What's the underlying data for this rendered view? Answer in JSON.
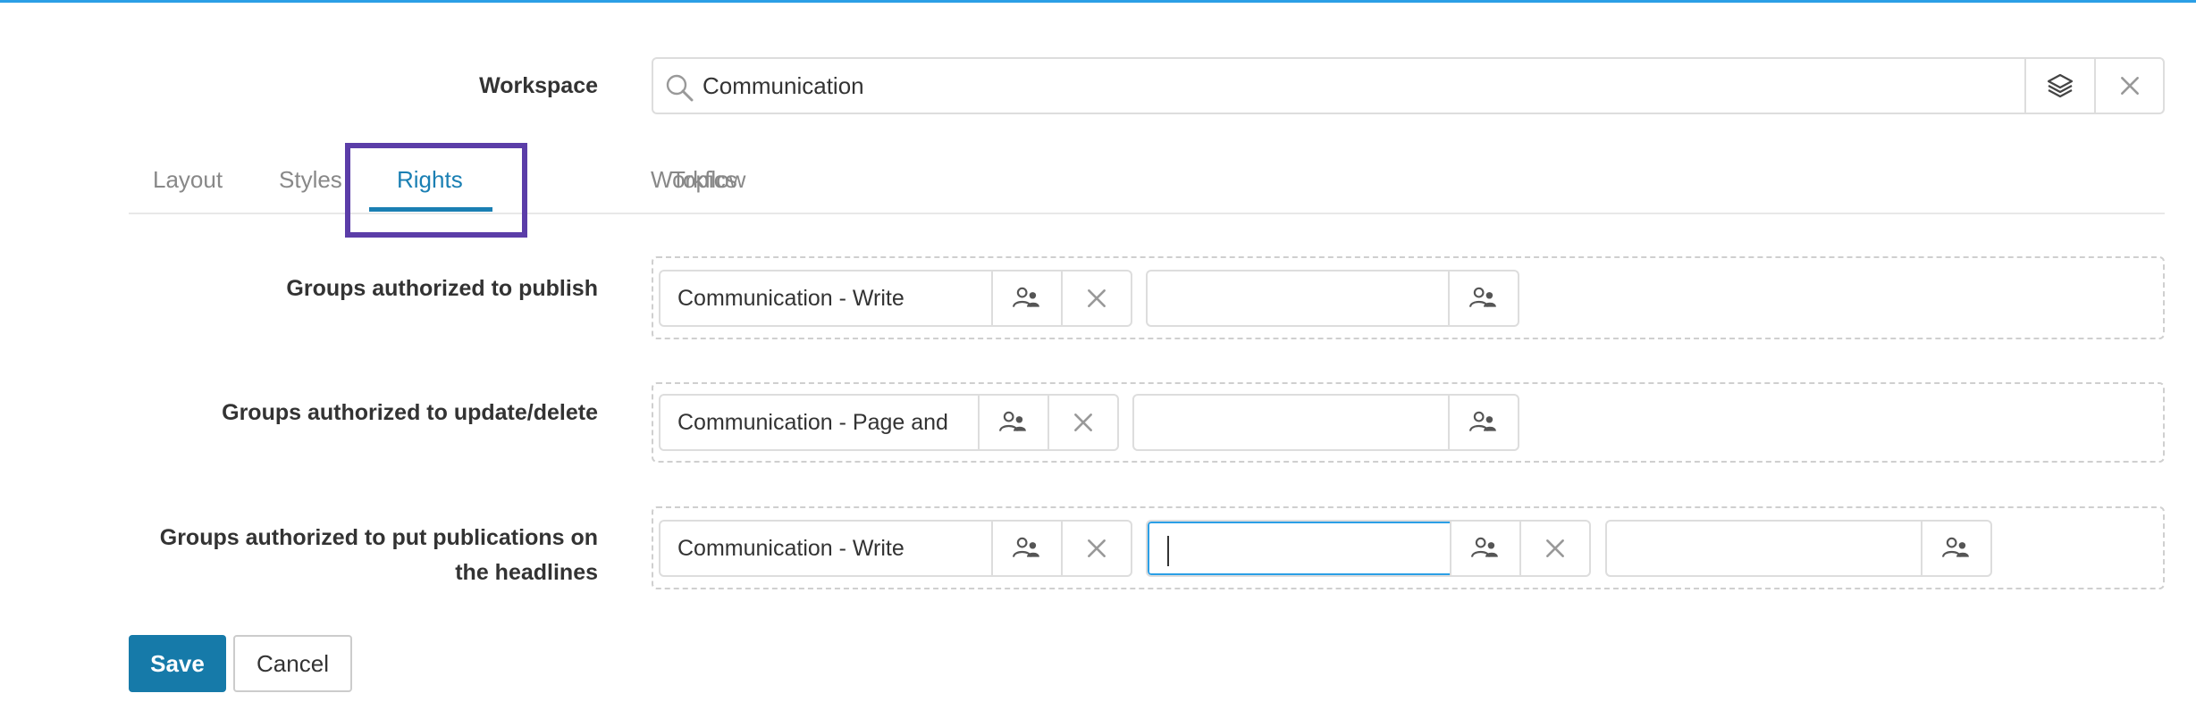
{
  "workspace": {
    "label": "Workspace",
    "value": "Communication",
    "icons": {
      "search": "search-icon",
      "layers": "layers-icon",
      "clear": "close-icon"
    }
  },
  "tabs": [
    {
      "label": "Layout",
      "active": false
    },
    {
      "label": "Styles",
      "active": false
    },
    {
      "label": "Rights",
      "active": true
    },
    {
      "label": "Workflow",
      "active": false
    },
    {
      "label": "Topics",
      "active": false
    }
  ],
  "rights": [
    {
      "label": "Groups authorized to publish",
      "groups": [
        "Communication - Write"
      ],
      "empty_input_value": ""
    },
    {
      "label": "Groups authorized to update/delete",
      "groups": [
        "Communication - Page and"
      ],
      "empty_input_value": ""
    },
    {
      "label_line1": "Groups authorized to put publications on",
      "label_line2": "the headlines",
      "groups": [
        "Communication - Write"
      ],
      "focused_input_value": "",
      "empty_input_value": ""
    }
  ],
  "actions": {
    "save": "Save",
    "cancel": "Cancel"
  },
  "colors": {
    "accent": "#167aa9",
    "tab_active": "#1a7fb3",
    "highlight": "#5b3da8",
    "focus": "#2b9fe6"
  }
}
